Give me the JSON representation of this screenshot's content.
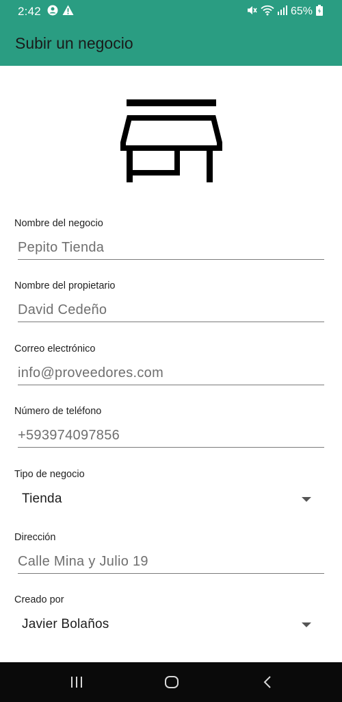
{
  "status_bar": {
    "time": "2:42",
    "battery": "65%",
    "icons": [
      "account-circle-icon",
      "warning-icon",
      "mute-icon",
      "wifi-icon",
      "signal-icon",
      "battery-icon"
    ]
  },
  "app_bar": {
    "title": "Subir un negocio",
    "color": "#2a9d82"
  },
  "header_icon": "store-icon",
  "form": {
    "business_name": {
      "label": "Nombre del negocio",
      "value": "Pepito Tienda"
    },
    "owner_name": {
      "label": "Nombre del propietario",
      "value": "David Cedeño"
    },
    "email": {
      "label": "Correo electrónico",
      "value": "info@proveedores.com"
    },
    "phone": {
      "label": "Número de teléfono",
      "value": "+593974097856"
    },
    "business_type": {
      "label": "Tipo de negocio",
      "selected": "Tienda"
    },
    "address": {
      "label": "Dirección",
      "value": "Calle Mina y Julio 19"
    },
    "created_by": {
      "label": "Creado por",
      "selected": "Javier Bolaños"
    }
  },
  "nav_bar": {
    "buttons": [
      "recent-apps-icon",
      "home-icon",
      "back-icon"
    ]
  }
}
